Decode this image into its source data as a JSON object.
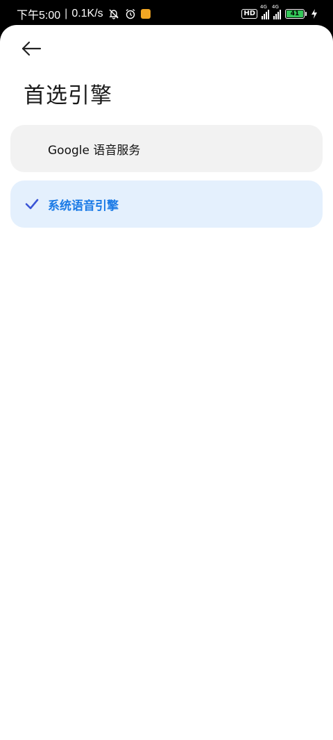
{
  "status_bar": {
    "time": "下午5:00",
    "separator": "|",
    "network_speed": "0.1K/s",
    "icons": [
      "mute-bell-icon",
      "alarm-icon",
      "app-notification-icon"
    ],
    "hd_label": "HD",
    "signal_tag_1": "4G",
    "signal_tag_2": "4G",
    "battery_level": "41",
    "charging": true
  },
  "header": {
    "back_icon": "arrow-left-icon",
    "title": "首选引擎"
  },
  "options": [
    {
      "label": "Google 语音服务",
      "selected": false
    },
    {
      "label": "系统语音引擎",
      "selected": true
    }
  ],
  "colors": {
    "selected_text": "#1a7ae6",
    "selected_bg": "#e4f0fd",
    "check": "#3a55d6",
    "unselected_bg": "#f2f2f2",
    "battery": "#34c759"
  }
}
